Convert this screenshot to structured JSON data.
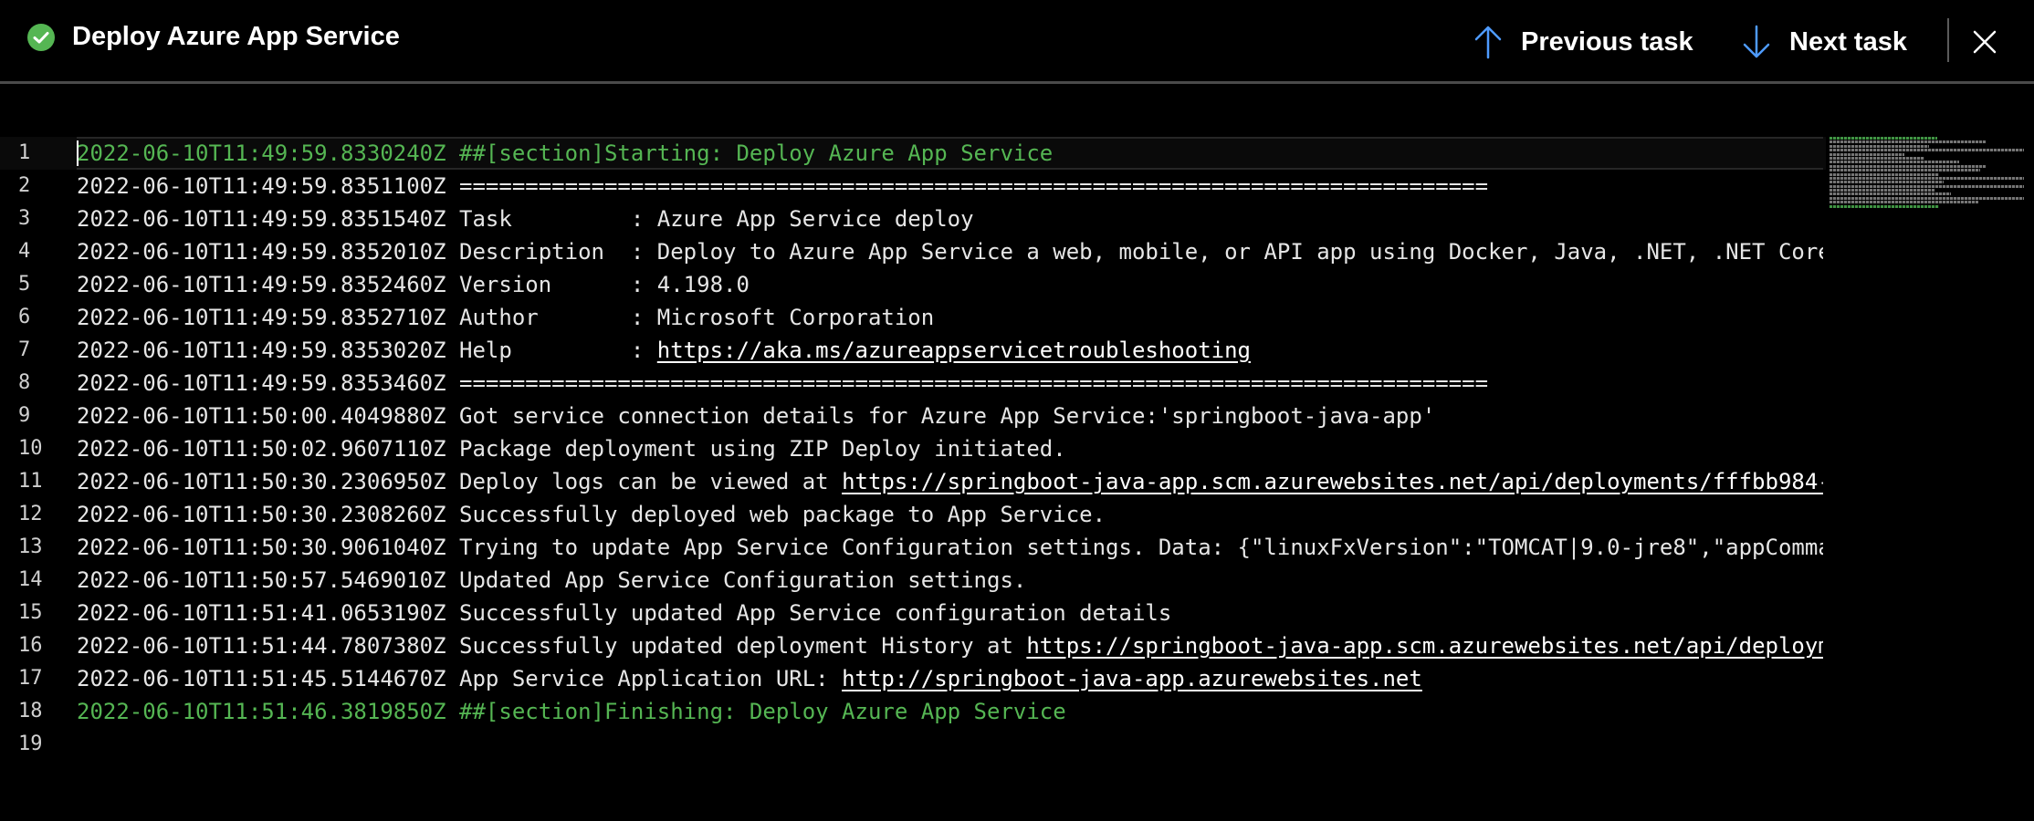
{
  "header": {
    "title": "Deploy Azure App Service",
    "prev_label": "Previous task",
    "next_label": "Next task"
  },
  "colors": {
    "success": "#55b653",
    "accent_arrow": "#4e9bff",
    "background": "#000000"
  },
  "icons": {
    "status": "check-circle-icon",
    "prev": "arrow-up-icon",
    "next": "arrow-down-icon",
    "close": "close-icon"
  },
  "log": {
    "lines": [
      {
        "n": "1",
        "ts": "2022-06-10T11:49:59.8330240Z",
        "text": "##[section]Starting: Deploy Azure App Service",
        "section": true
      },
      {
        "n": "2",
        "ts": "2022-06-10T11:49:59.8351100Z",
        "text": "=============================================================================="
      },
      {
        "n": "3",
        "ts": "2022-06-10T11:49:59.8351540Z",
        "text": "Task         : Azure App Service deploy"
      },
      {
        "n": "4",
        "ts": "2022-06-10T11:49:59.8352010Z",
        "text": "Description  : Deploy to Azure App Service a web, mobile, or API app using Docker, Java, .NET, .NET Core"
      },
      {
        "n": "5",
        "ts": "2022-06-10T11:49:59.8352460Z",
        "text": "Version      : 4.198.0"
      },
      {
        "n": "6",
        "ts": "2022-06-10T11:49:59.8352710Z",
        "text": "Author       : Microsoft Corporation"
      },
      {
        "n": "7",
        "ts": "2022-06-10T11:49:59.8353020Z",
        "text": "Help         : ",
        "link": "https://aka.ms/azureappservicetroubleshooting"
      },
      {
        "n": "8",
        "ts": "2022-06-10T11:49:59.8353460Z",
        "text": "=============================================================================="
      },
      {
        "n": "9",
        "ts": "2022-06-10T11:50:00.4049880Z",
        "text": "Got service connection details for Azure App Service:'springboot-java-app'"
      },
      {
        "n": "10",
        "ts": "2022-06-10T11:50:02.9607110Z",
        "text": "Package deployment using ZIP Deploy initiated."
      },
      {
        "n": "11",
        "ts": "2022-06-10T11:50:30.2306950Z",
        "text": "Deploy logs can be viewed at ",
        "link": "https://springboot-java-app.scm.azurewebsites.net/api/deployments/fffbb984-"
      },
      {
        "n": "12",
        "ts": "2022-06-10T11:50:30.2308260Z",
        "text": "Successfully deployed web package to App Service."
      },
      {
        "n": "13",
        "ts": "2022-06-10T11:50:30.9061040Z",
        "text": "Trying to update App Service Configuration settings. Data: {\"linuxFxVersion\":\"TOMCAT|9.0-jre8\",\"appComma"
      },
      {
        "n": "14",
        "ts": "2022-06-10T11:50:57.5469010Z",
        "text": "Updated App Service Configuration settings."
      },
      {
        "n": "15",
        "ts": "2022-06-10T11:51:41.0653190Z",
        "text": "Successfully updated App Service configuration details"
      },
      {
        "n": "16",
        "ts": "2022-06-10T11:51:44.7807380Z",
        "text": "Successfully updated deployment History at ",
        "link": "https://springboot-java-app.scm.azurewebsites.net/api/deploym"
      },
      {
        "n": "17",
        "ts": "2022-06-10T11:51:45.5144670Z",
        "text": "App Service Application URL: ",
        "link": "http://springboot-java-app.azurewebsites.net"
      },
      {
        "n": "18",
        "ts": "2022-06-10T11:51:46.3819850Z",
        "text": "##[section]Finishing: Deploy Azure App Service",
        "section": true
      },
      {
        "n": "19",
        "ts": "",
        "text": ""
      }
    ]
  }
}
